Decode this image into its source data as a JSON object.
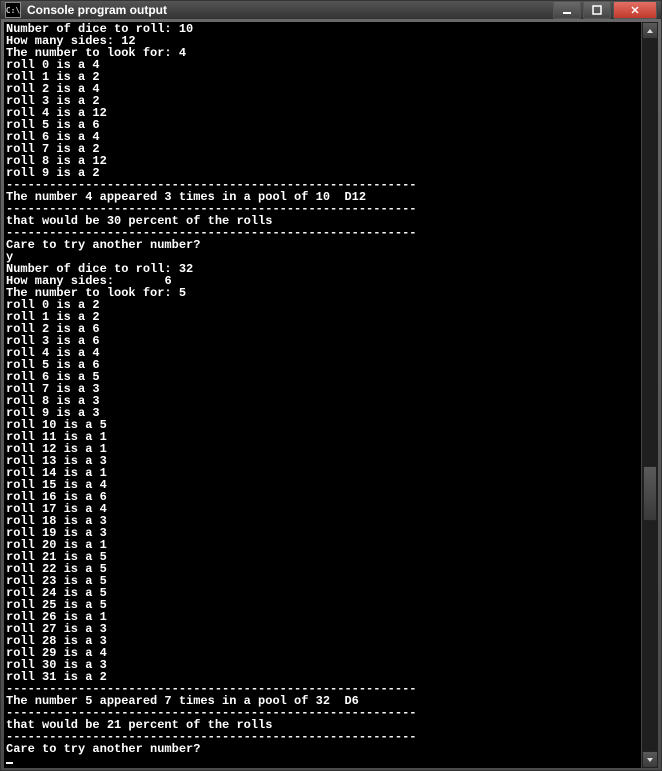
{
  "window": {
    "title": "Console program output",
    "icon_text": "C:\\"
  },
  "run1": {
    "dice_count_prompt": "Number of dice to roll: ",
    "dice_count": "10",
    "sides_prompt": "How many sides: ",
    "sides": "12",
    "look_for_prompt": "The number to look for: ",
    "look_for": "4",
    "rolls": [
      "roll 0 is a 4",
      "roll 1 is a 2",
      "roll 2 is a 4",
      "roll 3 is a 2",
      "roll 4 is a 12",
      "roll 5 is a 6",
      "roll 6 is a 4",
      "roll 7 is a 2",
      "roll 8 is a 12",
      "roll 9 is a 2"
    ],
    "sep": "---------------------------------------------------------",
    "result": "The number 4 appeared 3 times in a pool of 10  D12",
    "percent_line": "that would be 30 percent of the rolls",
    "again_prompt": "Care to try another number?",
    "again_answer": "y"
  },
  "run2": {
    "dice_count_prompt": "Number of dice to roll: ",
    "dice_count": "32",
    "sides_prompt": "How many sides:       ",
    "sides": "6",
    "look_for_prompt": "The number to look for: ",
    "look_for": "5",
    "rolls": [
      "roll 0 is a 2",
      "roll 1 is a 2",
      "roll 2 is a 6",
      "roll 3 is a 6",
      "roll 4 is a 4",
      "roll 5 is a 6",
      "roll 6 is a 5",
      "roll 7 is a 3",
      "roll 8 is a 3",
      "roll 9 is a 3",
      "roll 10 is a 5",
      "roll 11 is a 1",
      "roll 12 is a 1",
      "roll 13 is a 3",
      "roll 14 is a 1",
      "roll 15 is a 4",
      "roll 16 is a 6",
      "roll 17 is a 4",
      "roll 18 is a 3",
      "roll 19 is a 3",
      "roll 20 is a 1",
      "roll 21 is a 5",
      "roll 22 is a 5",
      "roll 23 is a 5",
      "roll 24 is a 5",
      "roll 25 is a 5",
      "roll 26 is a 1",
      "roll 27 is a 3",
      "roll 28 is a 3",
      "roll 29 is a 4",
      "roll 30 is a 3",
      "roll 31 is a 2"
    ],
    "sep": "---------------------------------------------------------",
    "result": "The number 5 appeared 7 times in a pool of 32  D6",
    "percent_line": "that would be 21 percent of the rolls",
    "again_prompt": "Care to try another number?"
  }
}
